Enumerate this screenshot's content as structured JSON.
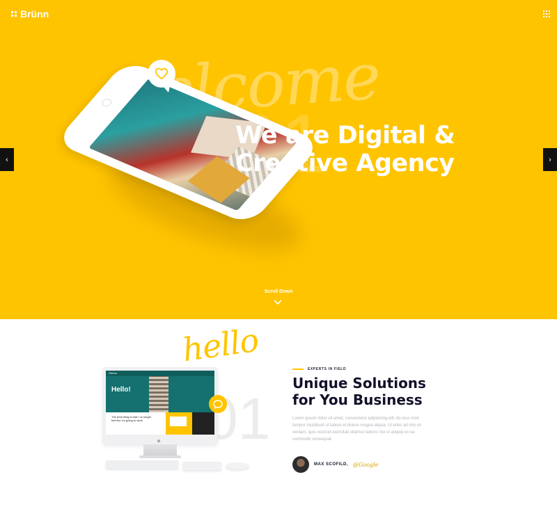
{
  "brand": {
    "name": "Brünn"
  },
  "hero": {
    "script_word": "welcome",
    "slide_number": "01",
    "title_line1": "We are Digital &",
    "title_line2": "Creative Agency",
    "scroll_label": "Scroll Down",
    "prev_label": "‹",
    "next_label": "›",
    "accent_color": "#ffc400"
  },
  "about": {
    "script_word": "hello",
    "slide_number": "01",
    "eyebrow": "EXPERTS IN FIELD",
    "title_line1": "Unique Solutions",
    "title_line2": "for You Business",
    "body": "Lorem ipsum dolor sit amet, consectetur adipisicing elit, do eius mod tempor incididunt ut labore et dolore magna aliqua. Ut enim ad min im veniam, quis nostrud exercitati ullamco laboris nisi ut aliquip ex ea commodo consequat.",
    "author_name": "MAX SCOFILD,",
    "author_company": "@Google",
    "mockup": {
      "hello": "Hello!",
      "nav_brand": "::Brünn",
      "caption": "The best thing is that I no longer feel like I'm going to work."
    }
  },
  "icons": {
    "logo": "grid-dots-icon",
    "menu": "grid-menu-icon",
    "heart": "heart-chat-icon",
    "chat": "chat-bubble-icon",
    "chevron": "chevron-down-icon"
  }
}
